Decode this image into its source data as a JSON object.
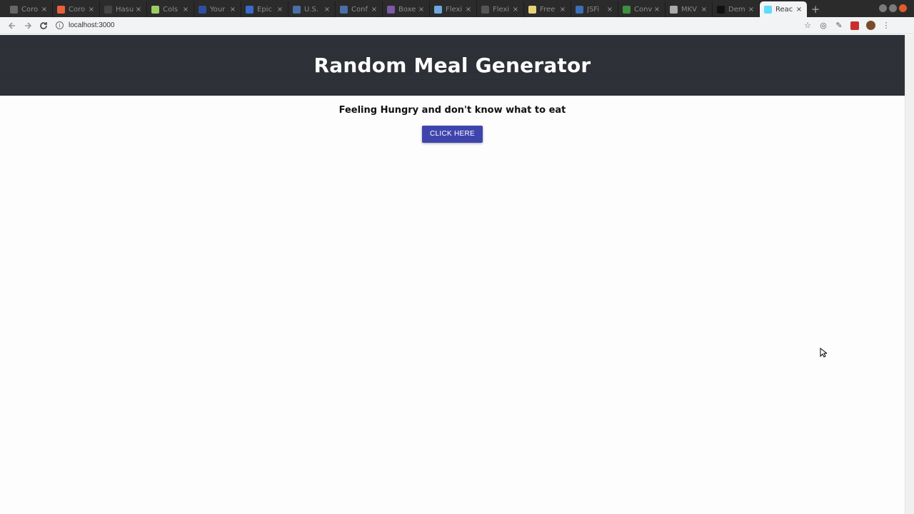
{
  "browser": {
    "tabs": [
      {
        "label": "Coro",
        "color": "#666666"
      },
      {
        "label": "Coro",
        "color": "#e8613a"
      },
      {
        "label": "Hasu",
        "color": "#444444"
      },
      {
        "label": "Cols",
        "color": "#9ccc65"
      },
      {
        "label": "Your",
        "color": "#2d4fa0"
      },
      {
        "label": "Epic",
        "color": "#3a6bc9"
      },
      {
        "label": "U.S.",
        "color": "#4a6fa5"
      },
      {
        "label": "Conf",
        "color": "#4a6fa5"
      },
      {
        "label": "Boxe",
        "color": "#7b5aa6"
      },
      {
        "label": "Flexi",
        "color": "#6fa8dc"
      },
      {
        "label": "Flexi",
        "color": "#555555"
      },
      {
        "label": "Free",
        "color": "#e6d27a"
      },
      {
        "label": "JSFi",
        "color": "#3b6fb6"
      },
      {
        "label": "Conv",
        "color": "#3f8f3f"
      },
      {
        "label": "MKV",
        "color": "#aaaaaa"
      },
      {
        "label": "Dem",
        "color": "#111111"
      },
      {
        "label": "Reac",
        "color": "#61dafb",
        "active": true
      }
    ],
    "new_tab": "+",
    "url": "localhost:3000"
  },
  "page": {
    "title": "Random Meal Generator",
    "prompt": "Feeling Hungry and don't know what to eat",
    "button_label": "CLICK HERE"
  },
  "colors": {
    "header_bg": "#2c2f35",
    "button_bg": "#3f44ad"
  }
}
